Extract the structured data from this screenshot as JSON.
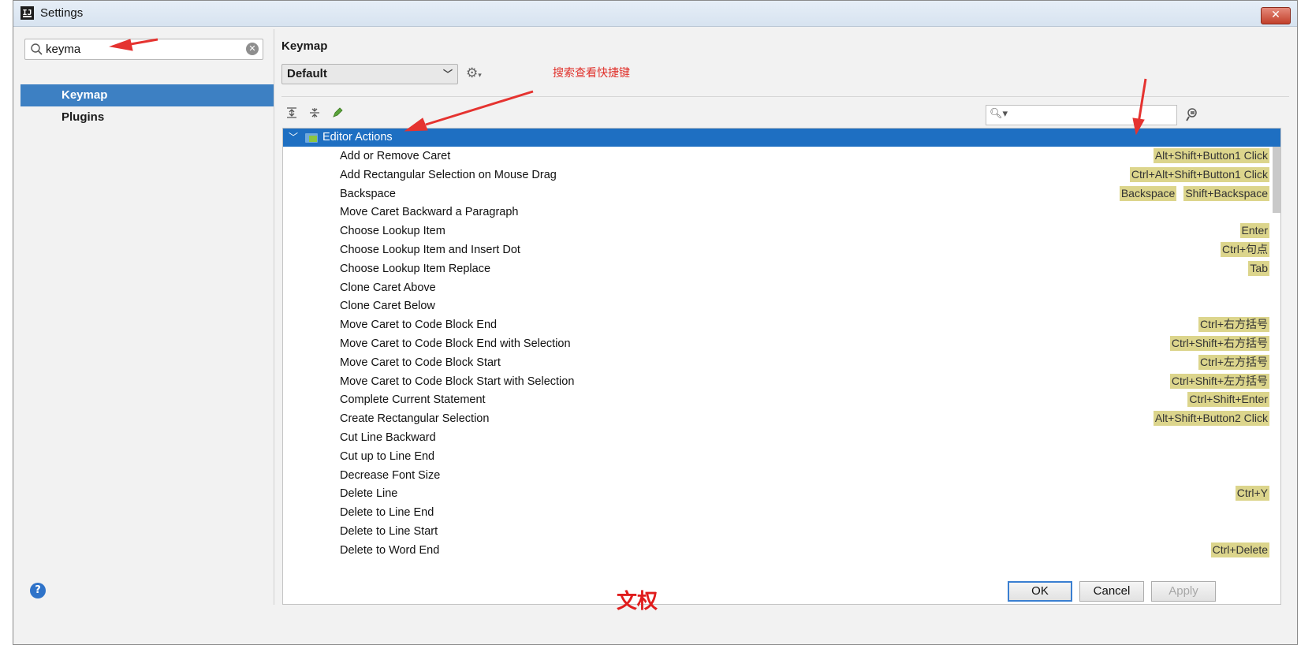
{
  "window": {
    "title": "Settings",
    "app_icon": "intellij-icon"
  },
  "search": {
    "value": "keyma"
  },
  "nav": {
    "items": [
      {
        "label": "Keymap",
        "selected": true
      },
      {
        "label": "Plugins",
        "selected": false
      }
    ]
  },
  "content": {
    "title": "Keymap",
    "keymap_select": "Default",
    "annotation": "搜索查看快捷键",
    "group": "Editor Actions",
    "rows": [
      {
        "name": "Add or Remove Caret",
        "shortcuts": [
          "Alt+Shift+Button1 Click"
        ]
      },
      {
        "name": "Add Rectangular Selection on Mouse Drag",
        "shortcuts": [
          "Ctrl+Alt+Shift+Button1 Click"
        ]
      },
      {
        "name": "Backspace",
        "shortcuts": [
          "Backspace",
          "Shift+Backspace"
        ]
      },
      {
        "name": "Move Caret Backward a Paragraph",
        "shortcuts": []
      },
      {
        "name": "Choose Lookup Item",
        "shortcuts": [
          "Enter"
        ]
      },
      {
        "name": "Choose Lookup Item and Insert Dot",
        "shortcuts": [
          "Ctrl+句点"
        ]
      },
      {
        "name": "Choose Lookup Item Replace",
        "shortcuts": [
          "Tab"
        ]
      },
      {
        "name": "Clone Caret Above",
        "shortcuts": []
      },
      {
        "name": "Clone Caret Below",
        "shortcuts": []
      },
      {
        "name": "Move Caret to Code Block End",
        "shortcuts": [
          "Ctrl+右方括号"
        ]
      },
      {
        "name": "Move Caret to Code Block End with Selection",
        "shortcuts": [
          "Ctrl+Shift+右方括号"
        ]
      },
      {
        "name": "Move Caret to Code Block Start",
        "shortcuts": [
          "Ctrl+左方括号"
        ]
      },
      {
        "name": "Move Caret to Code Block Start with Selection",
        "shortcuts": [
          "Ctrl+Shift+左方括号"
        ]
      },
      {
        "name": "Complete Current Statement",
        "shortcuts": [
          "Ctrl+Shift+Enter"
        ]
      },
      {
        "name": "Create Rectangular Selection",
        "shortcuts": [
          "Alt+Shift+Button2 Click"
        ]
      },
      {
        "name": "Cut Line Backward",
        "shortcuts": []
      },
      {
        "name": "Cut up to Line End",
        "shortcuts": []
      },
      {
        "name": "Decrease Font Size",
        "shortcuts": []
      },
      {
        "name": "Delete Line",
        "shortcuts": [
          "Ctrl+Y"
        ]
      },
      {
        "name": "Delete to Line End",
        "shortcuts": []
      },
      {
        "name": "Delete to Line Start",
        "shortcuts": []
      },
      {
        "name": "Delete to Word End",
        "shortcuts": [
          "Ctrl+Delete"
        ]
      }
    ]
  },
  "buttons": {
    "ok": "OK",
    "cancel": "Cancel",
    "apply": "Apply"
  },
  "watermark": "文权",
  "colors": {
    "selection": "#1e6fc2",
    "shortcut_bg": "#dcd58c",
    "annotation": "#e0302a"
  }
}
